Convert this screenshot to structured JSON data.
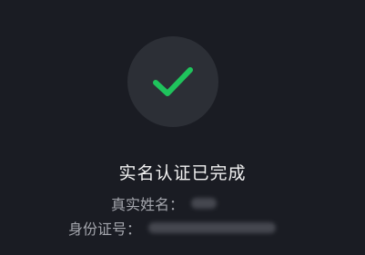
{
  "status": {
    "icon": "check-icon",
    "title": "实名认证已完成",
    "accent_color": "#1fc35c"
  },
  "info": {
    "name_label": "真实姓名：",
    "id_label": "身份证号："
  }
}
